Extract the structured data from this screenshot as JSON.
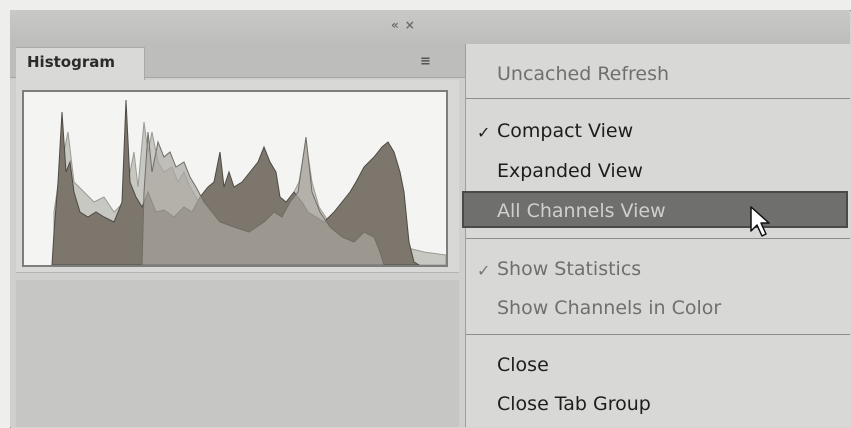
{
  "panel": {
    "tab_label": "Histogram",
    "collapse_glyph": "«",
    "close_glyph": "×",
    "menu_icon": "≡"
  },
  "menu": {
    "uncached_refresh": "Uncached Refresh",
    "compact_view": "Compact View",
    "expanded_view": "Expanded View",
    "all_channels_view": "All Channels View",
    "show_statistics": "Show Statistics",
    "show_channels_in_color": "Show Channels in Color",
    "close": "Close",
    "close_tab_group": "Close Tab Group",
    "check_glyph": "✓"
  },
  "colors": {
    "highlight": "#6f6f6d",
    "histogram_fill": "#7c766c"
  }
}
